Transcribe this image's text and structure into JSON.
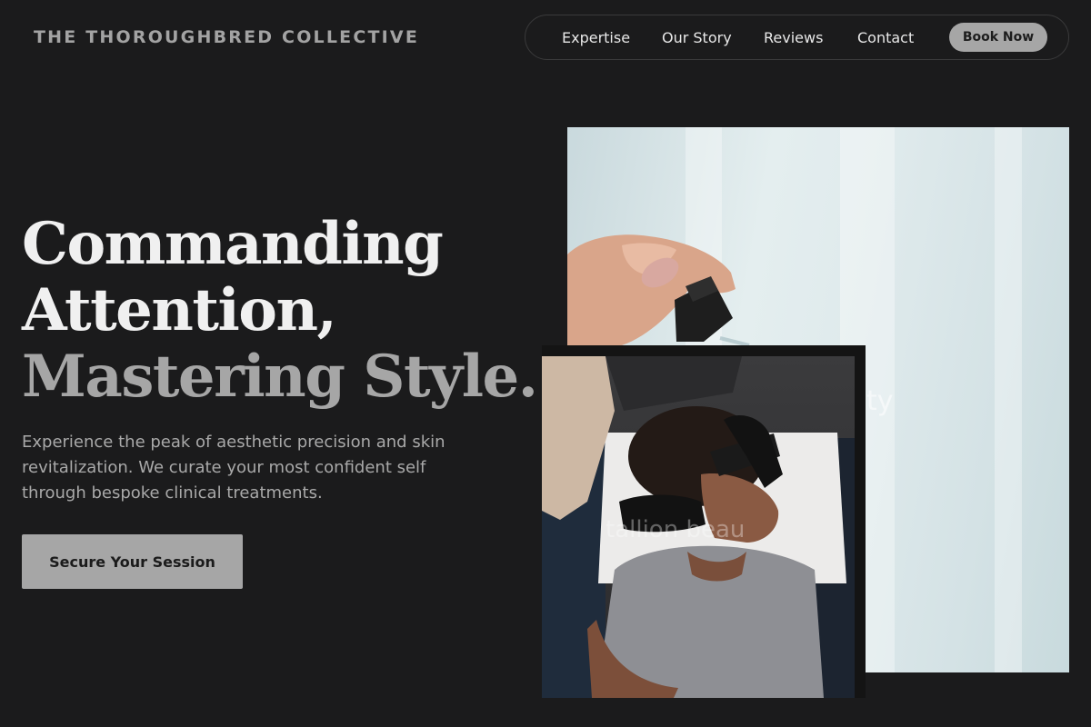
{
  "header": {
    "brand": "THE THOROUGHBRED COLLECTIVE",
    "nav": [
      {
        "label": "Expertise"
      },
      {
        "label": "Our Story"
      },
      {
        "label": "Reviews"
      },
      {
        "label": "Contact"
      }
    ],
    "cta_label": "Book Now"
  },
  "hero": {
    "headline_line1": "Commanding",
    "headline_line2": "Attention,",
    "headline_line3": "Mastering Style.",
    "lead": "Experience the peak of aesthetic precision and skin revitalization. We curate your most confident self through bespoke clinical treatments.",
    "cta_label": "Secure Your Session"
  },
  "images": {
    "back_ghost_text": "uty",
    "front_ghost_text": "tallion beau"
  },
  "colors": {
    "background": "#1b1b1c",
    "accent": "#a6a6a6",
    "text": "#f0f0f0"
  }
}
